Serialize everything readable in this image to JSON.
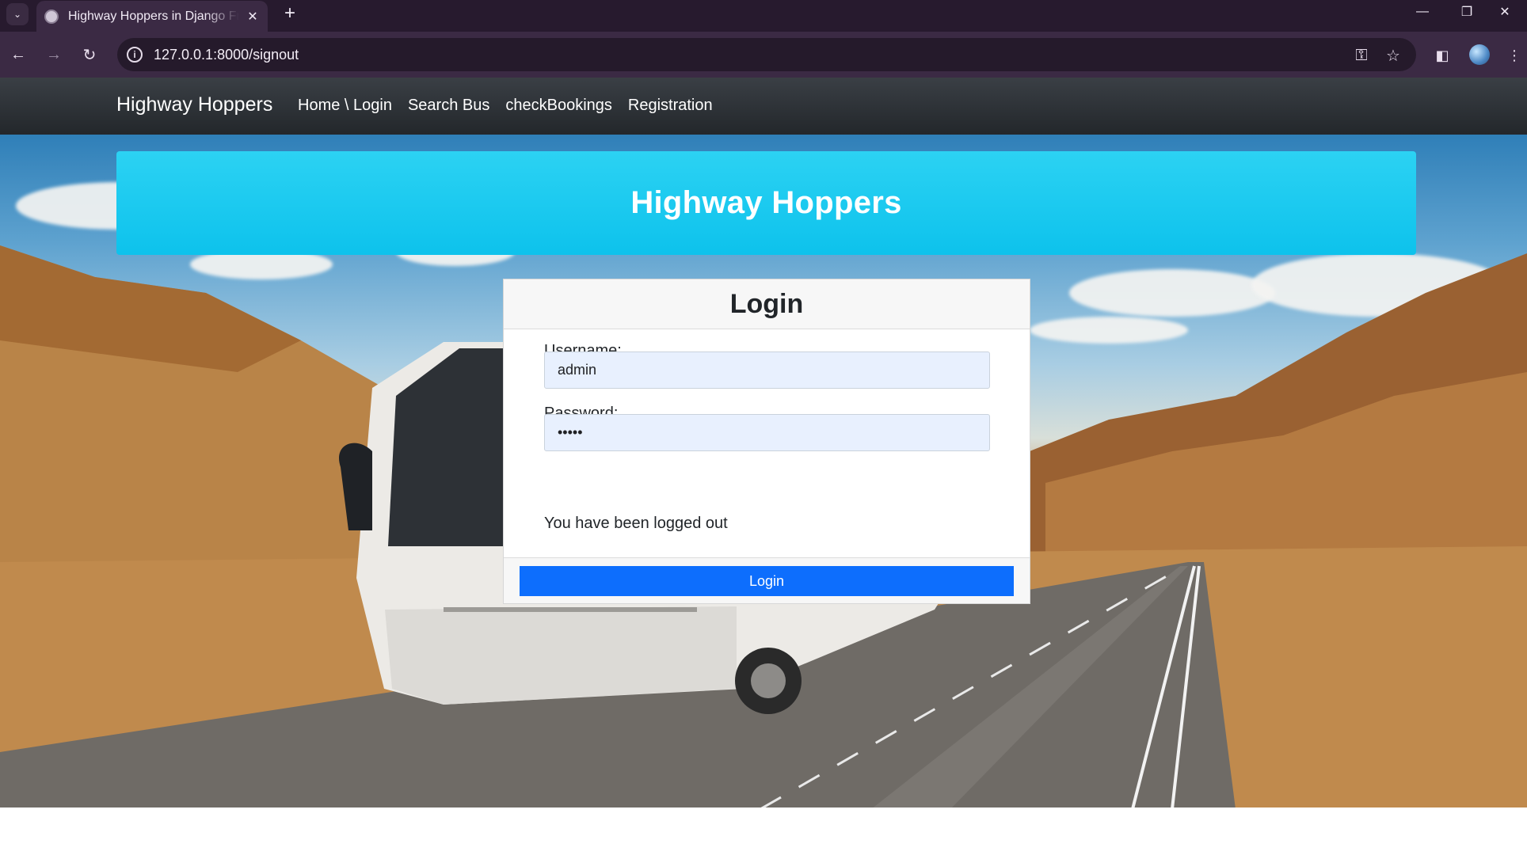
{
  "browser": {
    "tab_title": "Highway Hoppers in Django Framework",
    "url": "127.0.0.1:8000/signout",
    "icons": [
      "tab-search-icon",
      "globe-icon",
      "close-icon",
      "plus-icon",
      "minimize-icon",
      "restore-icon",
      "close-window-icon",
      "back-icon",
      "forward-icon",
      "reload-icon",
      "info-icon",
      "key-icon",
      "star-icon",
      "sidepanel-icon",
      "menu-icon"
    ]
  },
  "navbar": {
    "brand": "Highway Hoppers",
    "links": [
      "Home \\ Login",
      "Search Bus",
      "checkBookings",
      "Registration"
    ]
  },
  "hero": {
    "title": "Highway Hoppers"
  },
  "login": {
    "title": "Login",
    "username_label": "Username:",
    "username_value": "admin",
    "password_label": "Password:",
    "password_value": "•••••",
    "message": "You have been logged out",
    "button": "Login"
  },
  "colors": {
    "hero": "#13c6ee",
    "button": "#0d6efd",
    "navbar": "#2b2f34",
    "browser_chrome": "#3b2a44"
  }
}
